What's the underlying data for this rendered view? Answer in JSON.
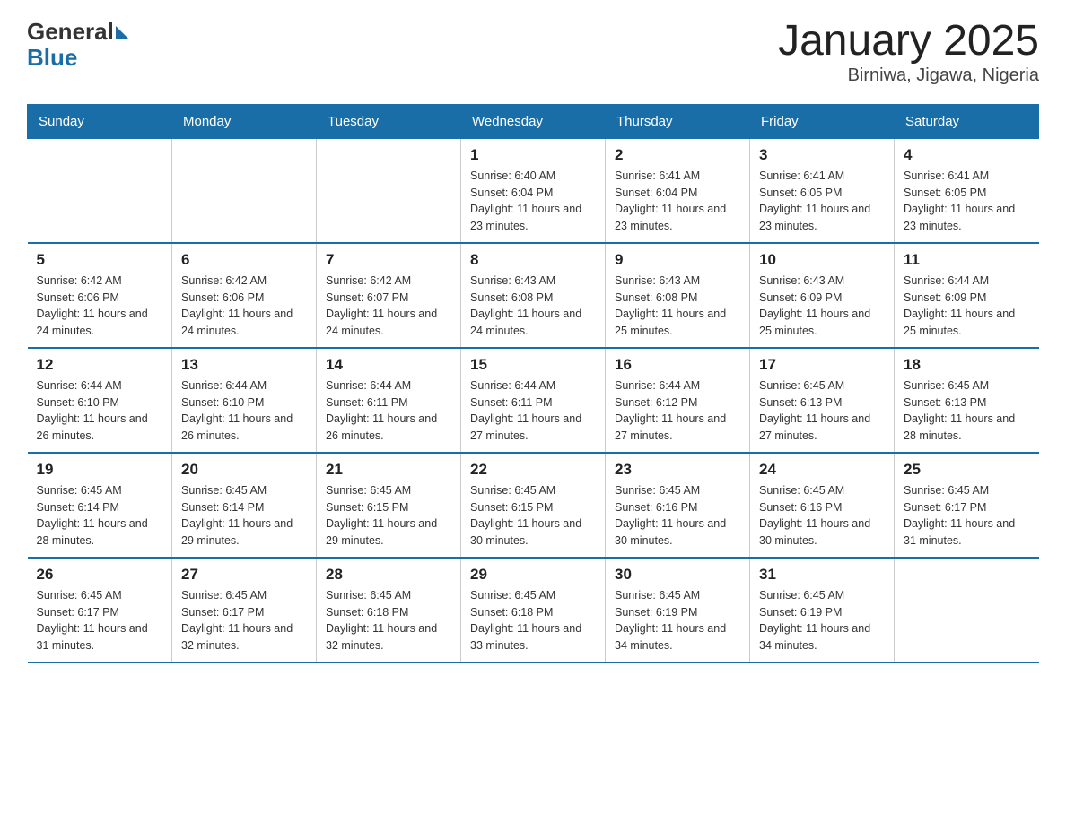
{
  "header": {
    "logo_general": "General",
    "logo_blue": "Blue",
    "title": "January 2025",
    "subtitle": "Birniwa, Jigawa, Nigeria"
  },
  "days_of_week": [
    "Sunday",
    "Monday",
    "Tuesday",
    "Wednesday",
    "Thursday",
    "Friday",
    "Saturday"
  ],
  "weeks": [
    [
      {
        "day": "",
        "info": ""
      },
      {
        "day": "",
        "info": ""
      },
      {
        "day": "",
        "info": ""
      },
      {
        "day": "1",
        "info": "Sunrise: 6:40 AM\nSunset: 6:04 PM\nDaylight: 11 hours and 23 minutes."
      },
      {
        "day": "2",
        "info": "Sunrise: 6:41 AM\nSunset: 6:04 PM\nDaylight: 11 hours and 23 minutes."
      },
      {
        "day": "3",
        "info": "Sunrise: 6:41 AM\nSunset: 6:05 PM\nDaylight: 11 hours and 23 minutes."
      },
      {
        "day": "4",
        "info": "Sunrise: 6:41 AM\nSunset: 6:05 PM\nDaylight: 11 hours and 23 minutes."
      }
    ],
    [
      {
        "day": "5",
        "info": "Sunrise: 6:42 AM\nSunset: 6:06 PM\nDaylight: 11 hours and 24 minutes."
      },
      {
        "day": "6",
        "info": "Sunrise: 6:42 AM\nSunset: 6:06 PM\nDaylight: 11 hours and 24 minutes."
      },
      {
        "day": "7",
        "info": "Sunrise: 6:42 AM\nSunset: 6:07 PM\nDaylight: 11 hours and 24 minutes."
      },
      {
        "day": "8",
        "info": "Sunrise: 6:43 AM\nSunset: 6:08 PM\nDaylight: 11 hours and 24 minutes."
      },
      {
        "day": "9",
        "info": "Sunrise: 6:43 AM\nSunset: 6:08 PM\nDaylight: 11 hours and 25 minutes."
      },
      {
        "day": "10",
        "info": "Sunrise: 6:43 AM\nSunset: 6:09 PM\nDaylight: 11 hours and 25 minutes."
      },
      {
        "day": "11",
        "info": "Sunrise: 6:44 AM\nSunset: 6:09 PM\nDaylight: 11 hours and 25 minutes."
      }
    ],
    [
      {
        "day": "12",
        "info": "Sunrise: 6:44 AM\nSunset: 6:10 PM\nDaylight: 11 hours and 26 minutes."
      },
      {
        "day": "13",
        "info": "Sunrise: 6:44 AM\nSunset: 6:10 PM\nDaylight: 11 hours and 26 minutes."
      },
      {
        "day": "14",
        "info": "Sunrise: 6:44 AM\nSunset: 6:11 PM\nDaylight: 11 hours and 26 minutes."
      },
      {
        "day": "15",
        "info": "Sunrise: 6:44 AM\nSunset: 6:11 PM\nDaylight: 11 hours and 27 minutes."
      },
      {
        "day": "16",
        "info": "Sunrise: 6:44 AM\nSunset: 6:12 PM\nDaylight: 11 hours and 27 minutes."
      },
      {
        "day": "17",
        "info": "Sunrise: 6:45 AM\nSunset: 6:13 PM\nDaylight: 11 hours and 27 minutes."
      },
      {
        "day": "18",
        "info": "Sunrise: 6:45 AM\nSunset: 6:13 PM\nDaylight: 11 hours and 28 minutes."
      }
    ],
    [
      {
        "day": "19",
        "info": "Sunrise: 6:45 AM\nSunset: 6:14 PM\nDaylight: 11 hours and 28 minutes."
      },
      {
        "day": "20",
        "info": "Sunrise: 6:45 AM\nSunset: 6:14 PM\nDaylight: 11 hours and 29 minutes."
      },
      {
        "day": "21",
        "info": "Sunrise: 6:45 AM\nSunset: 6:15 PM\nDaylight: 11 hours and 29 minutes."
      },
      {
        "day": "22",
        "info": "Sunrise: 6:45 AM\nSunset: 6:15 PM\nDaylight: 11 hours and 30 minutes."
      },
      {
        "day": "23",
        "info": "Sunrise: 6:45 AM\nSunset: 6:16 PM\nDaylight: 11 hours and 30 minutes."
      },
      {
        "day": "24",
        "info": "Sunrise: 6:45 AM\nSunset: 6:16 PM\nDaylight: 11 hours and 30 minutes."
      },
      {
        "day": "25",
        "info": "Sunrise: 6:45 AM\nSunset: 6:17 PM\nDaylight: 11 hours and 31 minutes."
      }
    ],
    [
      {
        "day": "26",
        "info": "Sunrise: 6:45 AM\nSunset: 6:17 PM\nDaylight: 11 hours and 31 minutes."
      },
      {
        "day": "27",
        "info": "Sunrise: 6:45 AM\nSunset: 6:17 PM\nDaylight: 11 hours and 32 minutes."
      },
      {
        "day": "28",
        "info": "Sunrise: 6:45 AM\nSunset: 6:18 PM\nDaylight: 11 hours and 32 minutes."
      },
      {
        "day": "29",
        "info": "Sunrise: 6:45 AM\nSunset: 6:18 PM\nDaylight: 11 hours and 33 minutes."
      },
      {
        "day": "30",
        "info": "Sunrise: 6:45 AM\nSunset: 6:19 PM\nDaylight: 11 hours and 34 minutes."
      },
      {
        "day": "31",
        "info": "Sunrise: 6:45 AM\nSunset: 6:19 PM\nDaylight: 11 hours and 34 minutes."
      },
      {
        "day": "",
        "info": ""
      }
    ]
  ]
}
